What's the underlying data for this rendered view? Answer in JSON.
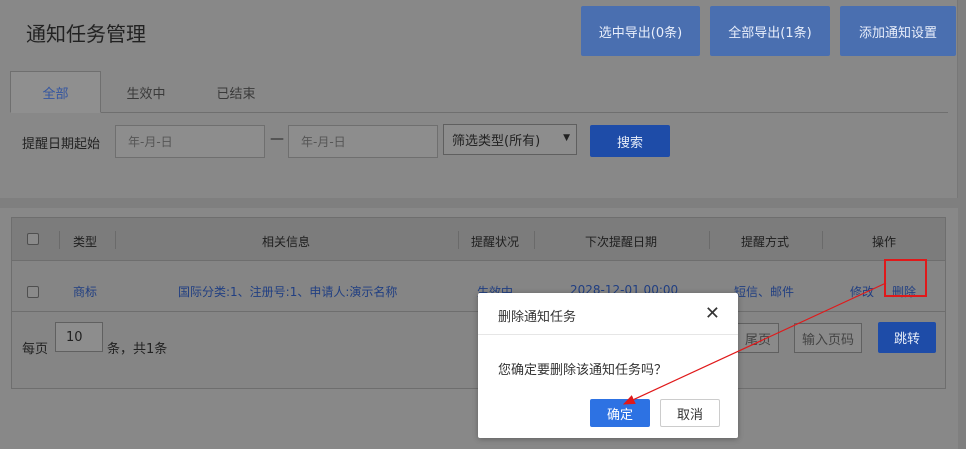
{
  "header": {
    "title": "通知任务管理",
    "export_selected": "选中导出(0条)",
    "export_all": "全部导出(1条)",
    "add_setting": "添加通知设置"
  },
  "tabs": [
    {
      "label": "全部",
      "active": true
    },
    {
      "label": "生效中",
      "active": false
    },
    {
      "label": "已结束",
      "active": false
    }
  ],
  "filter": {
    "date_label": "提醒日期起始",
    "date_start_placeholder": "年-月-日",
    "date_sep": "—",
    "date_end_placeholder": "年-月-日",
    "type_select": "筛选类型(所有)",
    "search_label": "搜索"
  },
  "table": {
    "headers": [
      "类型",
      "相关信息",
      "提醒状况",
      "下次提醒日期",
      "提醒方式",
      "操作"
    ],
    "rows": [
      {
        "type": "商标",
        "info": "国际分类:1、注册号:1、申请人:演示名称",
        "status": "生效中",
        "next_date": "2028-12-01 00:00",
        "method": "短信、邮件",
        "edit": "修改",
        "delete": "删除"
      }
    ]
  },
  "pager": {
    "per_page_label": "每页",
    "per_page_value": "10",
    "total_label": "条，共1条",
    "last_page": "尾页",
    "page_input_placeholder": "输入页码",
    "jump_label": "跳转"
  },
  "dialog": {
    "title": "删除通知任务",
    "message": "您确定要删除该通知任务吗？",
    "ok": "确定",
    "cancel": "取消"
  },
  "colors": {
    "accent": "#2d72e3",
    "highlight": "#e0191a"
  }
}
